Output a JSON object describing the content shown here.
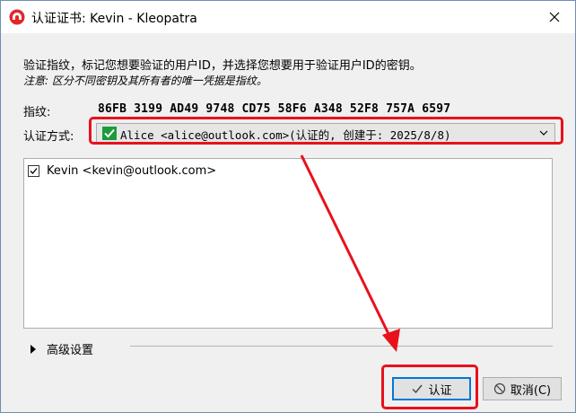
{
  "window": {
    "title": "认证证书: Kevin - Kleopatra",
    "app_icon": "kleopatra-icon",
    "close_icon": "close-icon"
  },
  "description": {
    "line1": "验证指纹，标记您想要验证的用户ID，并选择您想要用于验证用户ID的密钥。",
    "note": "注意: 区分不同密钥及其所有者的唯一凭据是指纹。"
  },
  "fingerprint": {
    "label": "指纹:",
    "value": "86FB 3199 AD49 9748 CD75 58F6 A348 52F8 757A 6597"
  },
  "certify_with": {
    "label": "认证方式:",
    "selected": "Alice <alice@outlook.com>(认证的, 创建于: 2025/8/8)",
    "icon": "green-check-icon"
  },
  "user_ids": [
    {
      "label": "Kevin <kevin@outlook.com>",
      "checked": true
    }
  ],
  "advanced": {
    "label": "高级设置"
  },
  "buttons": {
    "ok_label": "认证",
    "cancel_label": "取消(C)"
  },
  "annotation": {
    "color": "#e8111b"
  }
}
